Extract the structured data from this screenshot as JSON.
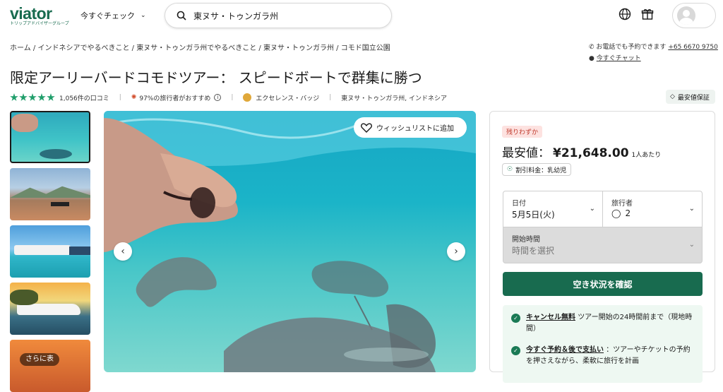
{
  "header": {
    "logo": "viator",
    "logo_sub": "トリップアドバイザーグループ",
    "explore_label": "今すぐチェック",
    "search_value": "東ヌサ・トゥンガラ州"
  },
  "breadcrumb": {
    "items": [
      "ホーム",
      "インドネシアでやるべきこと",
      "東ヌサ・トゥンガラ州でやるべきこと",
      "東ヌサ・トゥンガラ州",
      "コモド国立公園"
    ],
    "separator": "/"
  },
  "contact": {
    "phone_text": "お電話でも予約できます",
    "phone_number": "+65 6670 9750",
    "chat_label": "今すぐチャット"
  },
  "product": {
    "title": "限定アーリーバードコモドツアー： スピードボートで群集に勝つ",
    "rating": 5,
    "reviews": "1,056件の口コミ",
    "recommend": "97%の旅行者がおすすめ",
    "badge": "エクセレンス・バッジ",
    "location": "東ヌサ・トゥンガラ州, インドネシア",
    "guarantee": "最安値保証"
  },
  "gallery": {
    "more_label": "さらに表",
    "wishlist_label": "ウィッシュリストに追加"
  },
  "booking": {
    "scarcity": "残りわずか",
    "price_label": "最安値：",
    "price": "¥21,648.00",
    "per_person": "1人あたり",
    "discount": "割引料金：乳幼児",
    "date_label": "日付",
    "date_value": "5月5日(火)",
    "travelers_label": "旅行者",
    "travelers_value": "2",
    "time_label": "開始時間",
    "time_placeholder": "時間を選択",
    "check_button": "空き状況を確認",
    "cancel_link": "キャンセル無料",
    "cancel_text": "ツアー開始の24時間前まで（現地時間）",
    "pay_link": "今すぐ予約＆後で支払い",
    "pay_text": "：ツアーやチケットの予約を押さえながら、柔軟に旅行を計画"
  },
  "colors": {
    "brand": "#186b4f",
    "star": "#1f9e6a",
    "scarcity": "#c0392b"
  }
}
